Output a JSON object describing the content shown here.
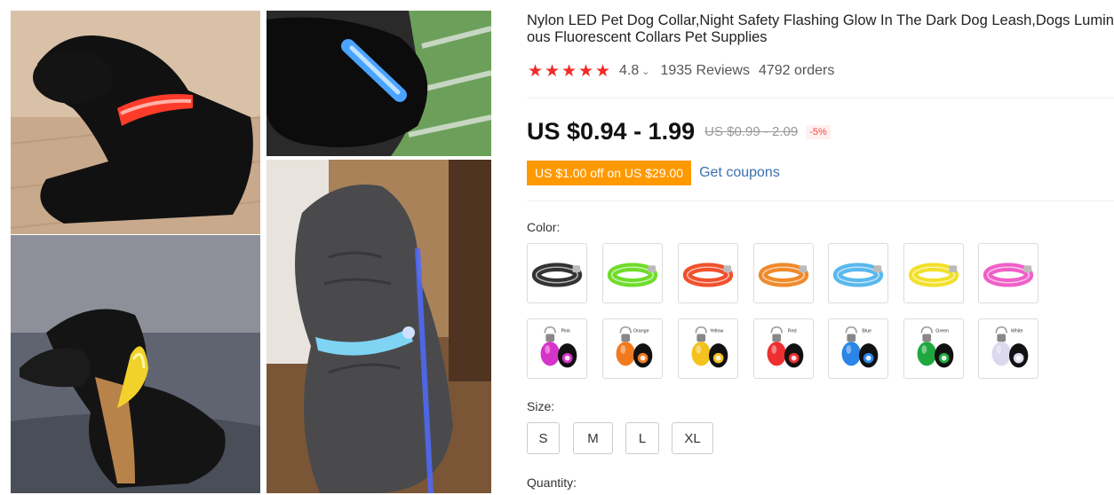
{
  "product": {
    "title": "Nylon LED Pet Dog Collar,Night Safety Flashing Glow In The Dark Dog Leash,Dogs Luminous Fluorescent Collars Pet Supplies",
    "rating": "4.8",
    "reviews": "1935 Reviews",
    "orders": "4792 orders"
  },
  "price": {
    "current": "US $0.94 - 1.99",
    "original": "US $0.99 - 2.09",
    "discount": "-5%"
  },
  "coupon": {
    "badge": "US $1.00 off on US $29.00",
    "link": "Get coupons"
  },
  "color": {
    "label": "Color:",
    "collars": [
      {
        "name": "black-collar",
        "color": "#333333"
      },
      {
        "name": "green-collar",
        "color": "#6fdc2c"
      },
      {
        "name": "red-collar",
        "color": "#f0502c"
      },
      {
        "name": "orange-collar",
        "color": "#f08a2c"
      },
      {
        "name": "blue-collar",
        "color": "#5ab8ee"
      },
      {
        "name": "yellow-collar",
        "color": "#f2e02a"
      },
      {
        "name": "pink-collar",
        "color": "#f060c8"
      }
    ],
    "pendants": [
      {
        "name": "pink-pendant",
        "text": "Pink",
        "color": "#d633c9"
      },
      {
        "name": "orange-pendant",
        "text": "Orange",
        "color": "#f27a1e"
      },
      {
        "name": "yellow-pendant",
        "text": "Yellow",
        "color": "#f4c21c"
      },
      {
        "name": "red-pendant",
        "text": "Red",
        "color": "#ee2f2f"
      },
      {
        "name": "blue-pendant",
        "text": "Blue",
        "color": "#2a86e6"
      },
      {
        "name": "green-pendant",
        "text": "Green",
        "color": "#20a83e"
      },
      {
        "name": "white-pendant",
        "text": "White",
        "color": "#dcd8ee"
      }
    ]
  },
  "size": {
    "label": "Size:",
    "options": [
      "S",
      "M",
      "L",
      "XL"
    ]
  },
  "quantity": {
    "label": "Quantity:"
  }
}
